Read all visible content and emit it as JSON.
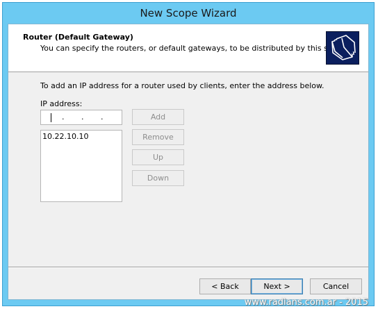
{
  "window": {
    "title": "New Scope Wizard"
  },
  "header": {
    "title": "Router (Default Gateway)",
    "subtitle": "You can specify the routers, or default gateways, to be distributed by this scope.",
    "icon": "folders-icon"
  },
  "body": {
    "instruction": "To add an IP address for a router used by clients, enter the address below.",
    "ip_label": "IP address:",
    "ip_separator": ".",
    "list_items": [
      "10.22.10.10"
    ]
  },
  "side_buttons": {
    "add": "Add",
    "remove": "Remove",
    "up": "Up",
    "down": "Down"
  },
  "footer_buttons": {
    "back": "< Back",
    "next": "Next >",
    "cancel": "Cancel"
  },
  "watermark": "www.radians.com.ar - 2015",
  "colors": {
    "titlebar": "#6ccaf2",
    "client": "#f0f0f0",
    "icon_bg": "#0b1f5e"
  }
}
